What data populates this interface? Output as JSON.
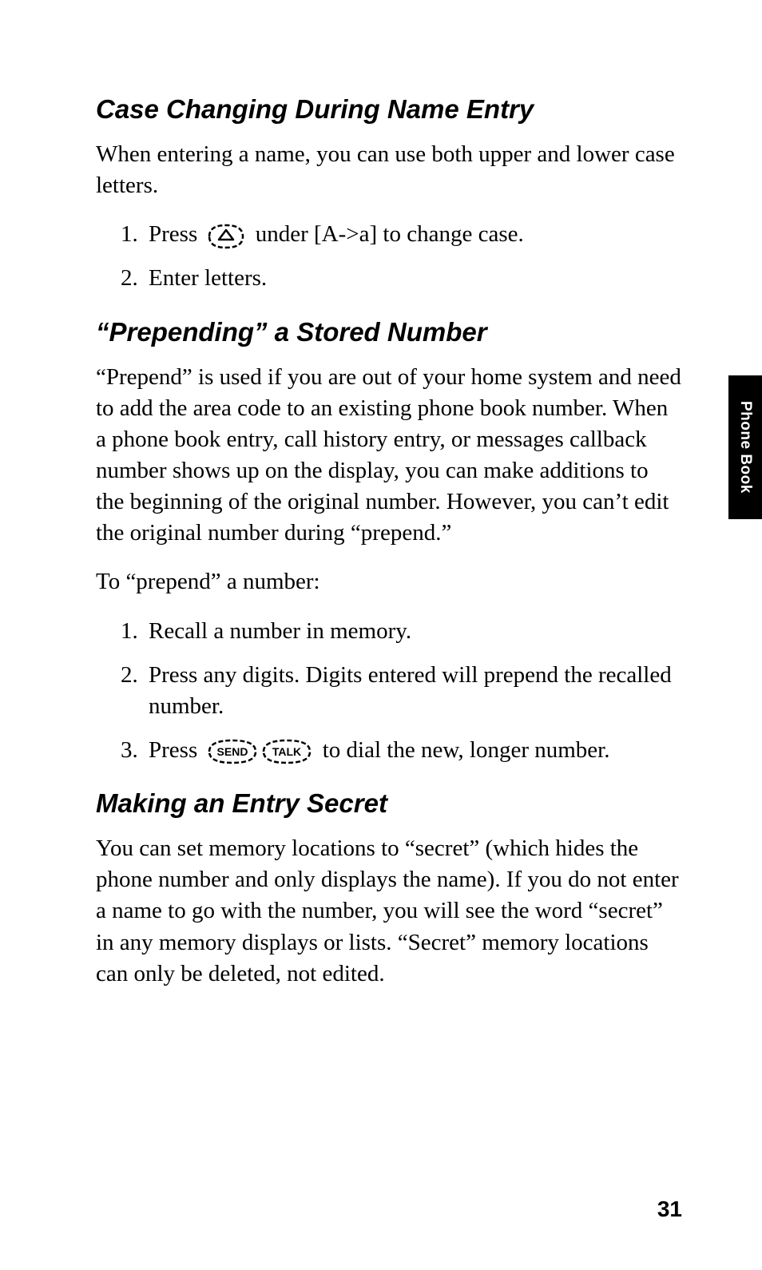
{
  "sideTab": "Phone Book",
  "pageNumber": "31",
  "s1": {
    "heading": "Case Changing During Name Entry",
    "p1": "When entering a name, you can use both upper and lower case letters.",
    "li1_a": "Press",
    "li1_b": "under [A->a] to change case.",
    "li2": "Enter letters."
  },
  "s2": {
    "heading": "“Prepending” a Stored Number",
    "p1": "“Prepend” is used if you are out of your home system and need to add the area code to an existing phone book number. When a phone book entry, call history entry, or messages callback number shows up on the display, you can make additions to the beginning of the original number. However, you can’t edit the original number during “prepend.”",
    "p2": "To “prepend” a number:",
    "li1": "Recall a number in memory.",
    "li2": "Press any digits. Digits entered will prepend the recalled number.",
    "li3_a": "Press",
    "li3_b": "to dial the new, longer number."
  },
  "s3": {
    "heading": "Making an Entry Secret",
    "p1": "You can set memory locations to “secret” (which hides the phone number and only displays the name). If you do not enter a name to go with the number, you will see the word “secret” in any memory displays or lists. “Secret” memory locations can only be deleted, not edited."
  },
  "icons": {
    "up": "up-arrow-key",
    "send": "SEND",
    "talk": "TALK"
  }
}
